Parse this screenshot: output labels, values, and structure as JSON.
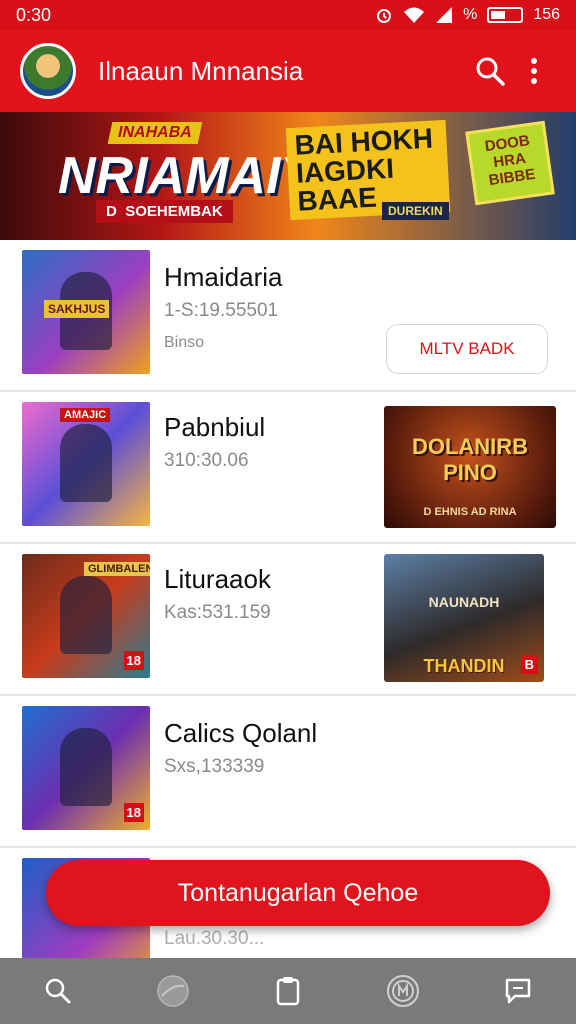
{
  "status": {
    "time": "0:30",
    "battery_text": "%",
    "signal_text": "156"
  },
  "app_bar": {
    "title": "Ilnaaun Mnnansia"
  },
  "banner": {
    "tag_top": "INAHABA",
    "headline": "NRIAMAIY",
    "tag_bottom_prefix": "D",
    "tag_bottom": "SOEHEMBAK",
    "highlight": "BAI HOKH IAGDKI BAAE",
    "badge": "DOOB HRA BIBBE",
    "small_tag": "DUREKIN"
  },
  "games": [
    {
      "title": "Hmaidaria",
      "meta": "1-S:19.55501",
      "meta2": "Binso",
      "thumb_label": "SAKHJUS",
      "action_label": "MLTV BADK"
    },
    {
      "title": "Pabnbiul",
      "meta": "310:30.06",
      "thumb_label": "AMAJIC",
      "promo_title": "DOLANIRB PINO",
      "promo_sub": "D EHNIS AD RINA"
    },
    {
      "title": "Lituraaok",
      "meta": "Kas:531.159",
      "thumb_label": "GLIMBALEN",
      "thumb_age": "18",
      "promo_title": "NAUNADH",
      "promo_sub": "THANDIN",
      "promo_age": "B"
    },
    {
      "title": "Calics Qolanl",
      "meta": "Sxs,133339",
      "thumb_age": "18"
    },
    {
      "title": "",
      "meta": "Lau.30.30..."
    }
  ],
  "fab_label": "Tontanugarlan Qehoe",
  "colors": {
    "brand_red": "#e2121b",
    "status_red": "#d80f16",
    "nav_gray": "#7a7a7a"
  }
}
